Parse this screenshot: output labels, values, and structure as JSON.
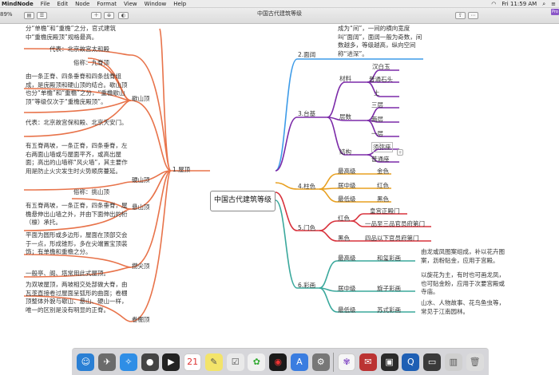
{
  "menubar": {
    "app": "MindNode",
    "items": [
      "File",
      "Edit",
      "Node",
      "Format",
      "View",
      "Window",
      "Help"
    ],
    "clock": "Fri 11:59 AM"
  },
  "toolbar": {
    "zoom": "89%",
    "title": "中国古代建筑等级",
    "pro_badge": "Pro"
  },
  "map": {
    "center": "中国古代建筑等级",
    "right": {
      "b2": {
        "label": "2.面阔",
        "note": "成为“间”，一间的横向宽度叫“面阔”，面阔一般为奇数，间数越多，等级越高，纵向空间称“进深”。"
      },
      "b3": {
        "label": "3.台基",
        "material": {
          "label": "材料",
          "items": [
            "汉白玉",
            "普通石头",
            "土"
          ]
        },
        "layers": {
          "label": "层数",
          "items": [
            "三层",
            "两层",
            "一层"
          ]
        },
        "structure": {
          "label": "结构",
          "items": [
            "须弥座",
            "普通座"
          ]
        }
      },
      "b4": {
        "label": "4.柱色",
        "rows": [
          {
            "level": "最高级",
            "color": "金色"
          },
          {
            "level": "居中级",
            "color": "红色"
          },
          {
            "level": "最低级",
            "color": "黑色"
          }
        ]
      },
      "b5": {
        "label": "5.门色",
        "red": "红色",
        "red_items": [
          "皇宫正殿门",
          "一品至三品官员府第门"
        ],
        "black": "黑色",
        "black_item": "四品以下官员府第门"
      },
      "b6": {
        "label": "6.彩画",
        "rows": [
          {
            "level": "最高级",
            "name": "和玺彩画",
            "desc": "由龙或凤图案组成，补以花卉图案，沥粉贴金，应用于宫殿。"
          },
          {
            "level": "居中级",
            "name": "旋子彩画",
            "desc": "以旋花为主，有时也可画龙凤，也可贴金粉，应用于次要宫殿或寺庙。"
          },
          {
            "level": "最低级",
            "name": "苏式彩画",
            "desc": "山水、人物故事、花鸟鱼虫等，常见于江南园林。"
          }
        ]
      }
    },
    "left": {
      "b1": "1.屋顶",
      "top_note": "分“单檐”和“重檐”之分，官式建筑中“重檐庑殿顶”规格最高。",
      "top_example": "代表：北京故宫太和殿",
      "xieshan": {
        "label": "歇山顶",
        "alias": "俗称：九脊顶",
        "desc": "由一条正脊、四条垂脊和四条戗脊组成，是庑殿顶和硬山顶的结合。歇山顶也分“单檐”和“重檐”之分，“重檐歇山顶”等级仅次于“重檐庑殿顶”。",
        "example": "代表：北京故宫保和殿、北京天安门。"
      },
      "yingshan": {
        "label": "硬山顶",
        "desc": "有五脊两坡，一条正脊，四条垂脊，左右两面山墙或与屋面平齐，或高出屋面；高出的山墙称“风火墙”，其主要作用是防止火灾发生时火势顺房蔓延。"
      },
      "xuanshan": {
        "label": "悬山顶",
        "alias": "俗称：挑山顶",
        "desc": "有五脊两坡，一条正脊，四条垂脊，屋檐悬伸出山墙之外，并由下面伸出的桁（檩）承托。"
      },
      "cuanjian": {
        "label": "攒尖顶",
        "desc": "平面为圆形或多边形，屋面在顶部交会于一点，形成锥形，多在尖端置宝顶装饰；有单檐和重檐之分。",
        "note": "一般亭、阁、塔常用此式屋顶。"
      },
      "juanpeng": {
        "label": "卷棚顶",
        "desc": "为双坡屋顶，两坡相交处部做大脊，由瓦垄直接卷过屋面呈弧形的曲面；卷棚顶整体外貌与歇山、悬山、硬山一样，唯一的区别是没有明显的正脊。"
      }
    }
  },
  "colors": {
    "purple": "#7b2aa8",
    "orange": "#e8a020",
    "red": "#d8323c",
    "teal": "#3aa89c",
    "blue": "#3d9be8",
    "left_orange": "#e8734a"
  }
}
